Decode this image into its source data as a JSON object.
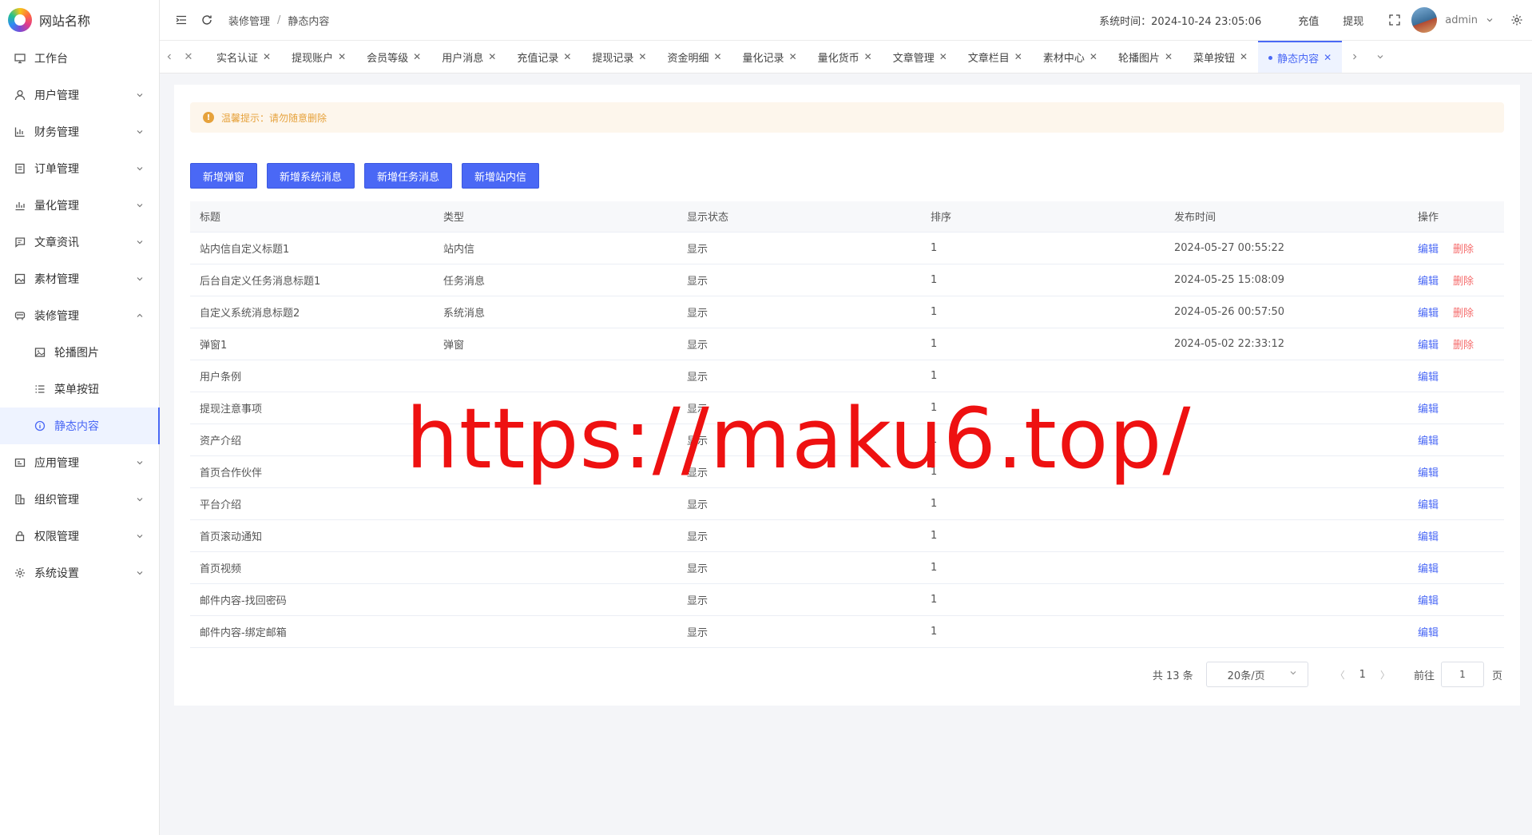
{
  "app": {
    "logo_text": "网站名称"
  },
  "sidebar": {
    "items": [
      {
        "label": "工作台",
        "icon": "monitor-icon"
      },
      {
        "label": "用户管理",
        "icon": "user-icon"
      },
      {
        "label": "财务管理",
        "icon": "chart-icon"
      },
      {
        "label": "订单管理",
        "icon": "order-icon"
      },
      {
        "label": "量化管理",
        "icon": "quant-icon"
      },
      {
        "label": "文章资讯",
        "icon": "message-icon"
      },
      {
        "label": "素材管理",
        "icon": "image-icon"
      },
      {
        "label": "装修管理",
        "icon": "decorate-icon"
      },
      {
        "label": "轮播图片",
        "icon": "picture-icon"
      },
      {
        "label": "菜单按钮",
        "icon": "list-icon"
      },
      {
        "label": "静态内容",
        "icon": "info-icon"
      },
      {
        "label": "应用管理",
        "icon": "app-icon"
      },
      {
        "label": "组织管理",
        "icon": "building-icon"
      },
      {
        "label": "权限管理",
        "icon": "lock-icon"
      },
      {
        "label": "系统设置",
        "icon": "gear-icon"
      }
    ]
  },
  "header": {
    "breadcrumb": [
      "装修管理",
      "静态内容"
    ],
    "sys_time": "系统时间：2024-10-24 23:05:06",
    "recharge": "充值",
    "withdraw": "提现",
    "user": "admin"
  },
  "tabs": [
    "实名认证",
    "提现账户",
    "会员等级",
    "用户消息",
    "充值记录",
    "提现记录",
    "资金明细",
    "量化记录",
    "量化货币",
    "文章管理",
    "文章栏目",
    "素材中心",
    "轮播图片",
    "菜单按钮",
    "静态内容"
  ],
  "alert": {
    "text": "温馨提示：请勿随意删除"
  },
  "buttons": {
    "add_popup": "新增弹窗",
    "add_system": "新增系统消息",
    "add_task": "新增任务消息",
    "add_mail": "新增站内信"
  },
  "table": {
    "headers": [
      "标题",
      "类型",
      "显示状态",
      "排序",
      "发布时间",
      "操作"
    ],
    "edit_label": "编辑",
    "delete_label": "删除",
    "rows": [
      {
        "title": "站内信自定义标题1",
        "type": "站内信",
        "status": "显示",
        "sort": "1",
        "time": "2024-05-27 00:55:22",
        "deletable": true
      },
      {
        "title": "后台自定义任务消息标题1",
        "type": "任务消息",
        "status": "显示",
        "sort": "1",
        "time": "2024-05-25 15:08:09",
        "deletable": true
      },
      {
        "title": "自定义系统消息标题2",
        "type": "系统消息",
        "status": "显示",
        "sort": "1",
        "time": "2024-05-26 00:57:50",
        "deletable": true
      },
      {
        "title": "弹窗1",
        "type": "弹窗",
        "status": "显示",
        "sort": "1",
        "time": "2024-05-02 22:33:12",
        "deletable": true
      },
      {
        "title": "用户条例",
        "type": "",
        "status": "显示",
        "sort": "1",
        "time": "",
        "deletable": false
      },
      {
        "title": "提现注意事项",
        "type": "",
        "status": "显示",
        "sort": "1",
        "time": "",
        "deletable": false
      },
      {
        "title": "资产介绍",
        "type": "",
        "status": "显示",
        "sort": "1",
        "time": "",
        "deletable": false
      },
      {
        "title": "首页合作伙伴",
        "type": "",
        "status": "显示",
        "sort": "1",
        "time": "",
        "deletable": false
      },
      {
        "title": "平台介绍",
        "type": "",
        "status": "显示",
        "sort": "1",
        "time": "",
        "deletable": false
      },
      {
        "title": "首页滚动通知",
        "type": "",
        "status": "显示",
        "sort": "1",
        "time": "",
        "deletable": false
      },
      {
        "title": "首页视频",
        "type": "",
        "status": "显示",
        "sort": "1",
        "time": "",
        "deletable": false
      },
      {
        "title": "邮件内容-找回密码",
        "type": "",
        "status": "显示",
        "sort": "1",
        "time": "",
        "deletable": false
      },
      {
        "title": "邮件内容-绑定邮箱",
        "type": "",
        "status": "显示",
        "sort": "1",
        "time": "",
        "deletable": false
      }
    ]
  },
  "pagination": {
    "total": "共 13 条",
    "page_size": "20条/页",
    "current": "1",
    "goto_label": "前往",
    "goto_value": "1",
    "page_suffix": "页"
  },
  "watermark": "https://maku6.top/",
  "colors": {
    "primary": "#4a68f5",
    "danger": "#f56c6c",
    "warning": "#e6a23c",
    "watermark": "#ee1111"
  }
}
